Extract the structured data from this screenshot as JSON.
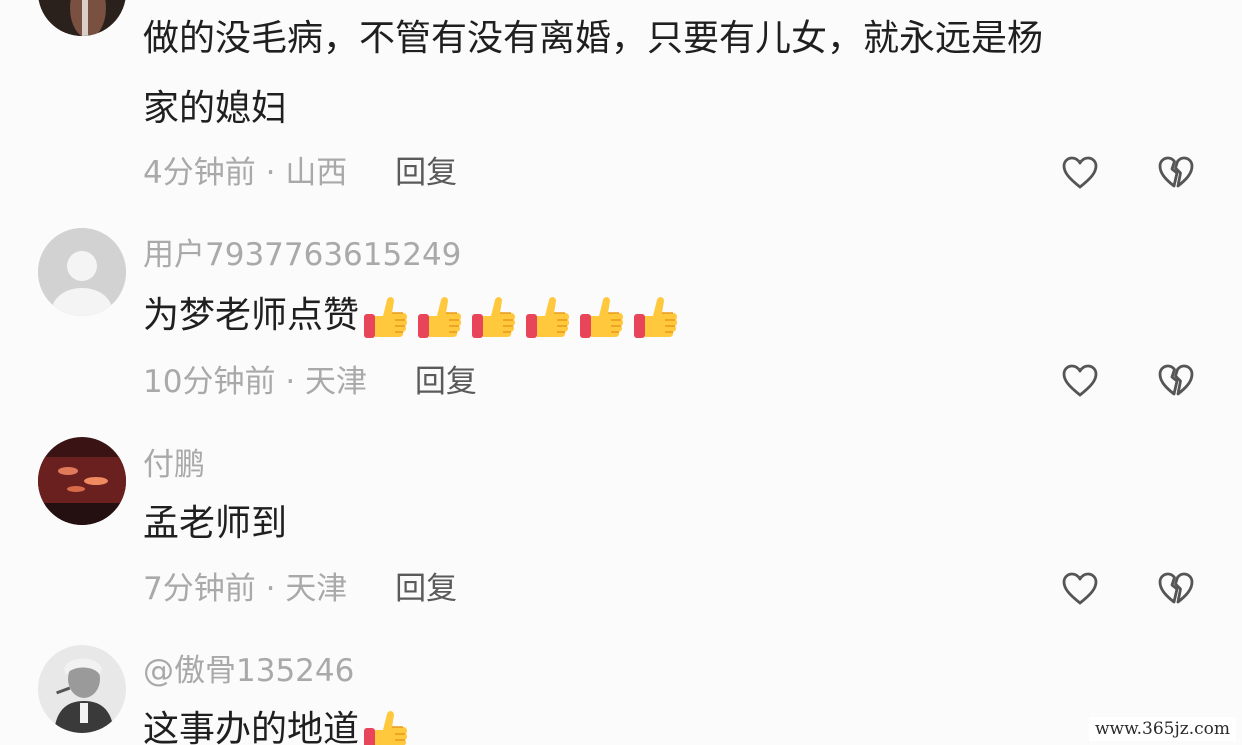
{
  "comments": [
    {
      "username": "",
      "text_lines": [
        "做的没毛病，不管有没有离婚，只要有儿女，就永远是杨",
        "家的媳妇"
      ],
      "time": "4分钟前",
      "location": "山西",
      "reply_label": "回复",
      "emoji_count": 0
    },
    {
      "username": "用户7937763615249",
      "text_lines": [
        "为梦老师点赞"
      ],
      "time": "10分钟前",
      "location": "天津",
      "reply_label": "回复",
      "emoji_count": 6
    },
    {
      "username": "付鹏",
      "text_lines": [
        "孟老师到"
      ],
      "time": "7分钟前",
      "location": "天津",
      "reply_label": "回复",
      "emoji_count": 0
    },
    {
      "username": "@傲骨135246",
      "text_lines": [
        "这事办的地道"
      ],
      "emoji_count": 1
    }
  ],
  "separator": "·",
  "icons": {
    "like": "heart-outline-icon",
    "dislike": "broken-heart-icon",
    "emoji": "thumbs-up-emoji"
  },
  "colors": {
    "text": "#1f1f1f",
    "meta": "#a9a9a9",
    "reply": "#5a5a5a",
    "icon": "#555555"
  },
  "watermark": "www.365jz.com"
}
